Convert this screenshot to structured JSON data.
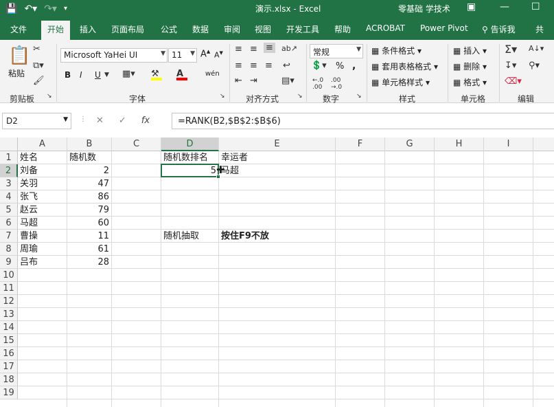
{
  "titlebar": {
    "title": "演示.xlsx  -  Excel",
    "user": "零基础 学技术",
    "qat_icons": [
      "save-icon",
      "undo-icon",
      "redo-icon",
      "customize-icon"
    ],
    "window_buttons": [
      "ribbon-display-icon",
      "minimize-icon",
      "maximize-icon"
    ]
  },
  "tabs": {
    "items": [
      "文件",
      "开始",
      "插入",
      "页面布局",
      "公式",
      "数据",
      "审阅",
      "视图",
      "开发工具",
      "帮助",
      "ACROBAT",
      "Power Pivot"
    ],
    "active": "开始",
    "tell_me": "告诉我",
    "share": "共"
  },
  "ribbon": {
    "clipboard": {
      "paste": "粘贴",
      "label": "剪贴板"
    },
    "font": {
      "name": "Microsoft YaHei UI",
      "size": "11",
      "bold": "B",
      "italic": "I",
      "underline": "U",
      "label": "字体",
      "phonetic": "wén"
    },
    "alignment": {
      "label": "对齐方式"
    },
    "number": {
      "format": "常规",
      "percent": "%",
      "comma": ",",
      "label": "数字"
    },
    "styles": {
      "conditional": "条件格式",
      "table": "套用表格格式",
      "cell": "单元格样式",
      "label": "样式"
    },
    "cells": {
      "insert": "插入",
      "delete": "删除",
      "format": "格式",
      "label": "单元格"
    },
    "editing": {
      "label": "编辑"
    }
  },
  "formula_bar": {
    "name_box": "D2",
    "formula": "=RANK(B2,$B$2:$B$6)",
    "fx": "fx"
  },
  "sheet": {
    "columns": [
      "A",
      "B",
      "C",
      "D",
      "E",
      "F",
      "G",
      "H",
      "I"
    ],
    "rows": [
      "1",
      "2",
      "3",
      "4",
      "5",
      "6",
      "7",
      "8",
      "9",
      "10",
      "11",
      "12",
      "13",
      "14",
      "15",
      "16",
      "17",
      "18",
      "19"
    ],
    "selected_cell": "D2",
    "cells": {
      "A1": "姓名",
      "B1": "随机数",
      "A2": "刘备",
      "B2": "2",
      "A3": "关羽",
      "B3": "47",
      "A4": "张飞",
      "B4": "86",
      "A5": "赵云",
      "B5": "79",
      "A6": "马超",
      "B6": "60",
      "A7": "曹操",
      "B7": "11",
      "A8": "周瑜",
      "B8": "61",
      "A9": "吕布",
      "B9": "28",
      "D1": "随机数排名",
      "E1": "幸运者",
      "D2": "5",
      "E2": "马超",
      "D7": "随机抽取",
      "E7": "按住F9不放"
    }
  }
}
